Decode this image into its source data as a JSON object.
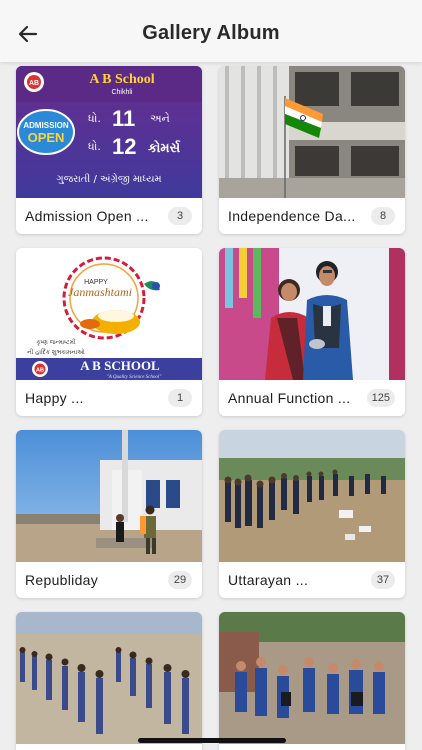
{
  "header": {
    "title": "Gallery Album",
    "back_icon": "arrow-left-icon"
  },
  "albums": [
    {
      "title": "Admission Open ...",
      "count": "3"
    },
    {
      "title": "Independence Da...",
      "count": "8"
    },
    {
      "title": "Happy ...",
      "count": "1"
    },
    {
      "title": "Annual Function ...",
      "count": "125"
    },
    {
      "title": "Republiday",
      "count": "29"
    },
    {
      "title": "Uttarayan ...",
      "count": "37"
    },
    {
      "title": "",
      "count": ""
    },
    {
      "title": "",
      "count": ""
    }
  ],
  "posters": {
    "admission": {
      "school_name": "A B School",
      "location": "Chikhli",
      "badge_line1": "ADMISSION",
      "badge_line2": "OPEN",
      "std1_prefix": "ધો.",
      "std1_num": "11",
      "std1_suffix": "અને",
      "std2_prefix": "ધો.",
      "std2_num": "12",
      "std2_suffix": "કોમર્સ",
      "medium": "ગુજરાતી / અંગ્રેજી માધ્યમ",
      "logo_text": "AB"
    },
    "janmashtami": {
      "happy": "HAPPY",
      "festival": "Janmashtami",
      "wish_line1": "કૃષ્ણ જન્માષ્ટમી",
      "wish_line2": "ની હાર્દિક શુભકામનાઓ",
      "school_name": "A B SCHOOL",
      "tagline": "\"A Quality Science School\"",
      "logo_text": "AB"
    }
  },
  "colors": {
    "header_bg": "#f7f7f8",
    "page_bg": "#eeeeef",
    "poster_blue": "#3b3f9e",
    "poster_purple": "#5a2a8a",
    "badge_blue": "#2a8ad8"
  }
}
